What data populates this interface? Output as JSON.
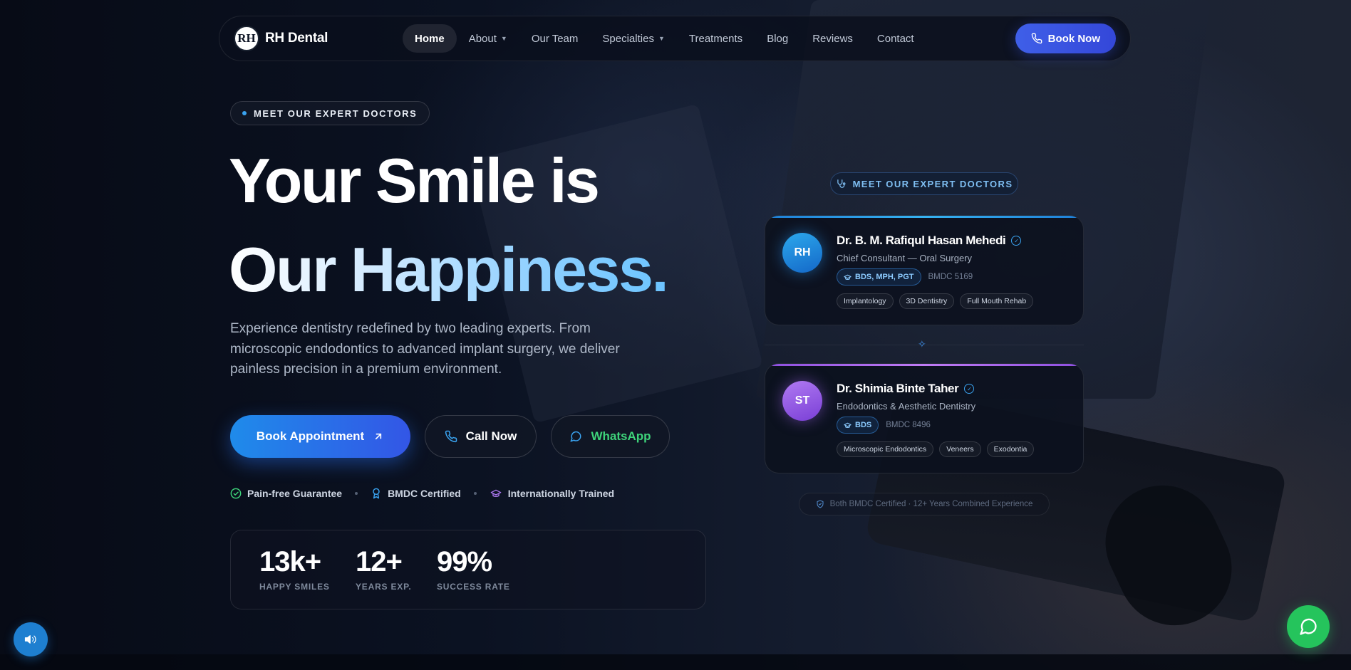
{
  "nav": {
    "brand_logo_text": "RH",
    "brand_name": "RH Dental",
    "items": [
      {
        "label": "Home",
        "active": true,
        "has_dropdown": false
      },
      {
        "label": "About",
        "active": false,
        "has_dropdown": true
      },
      {
        "label": "Our Team",
        "active": false,
        "has_dropdown": false
      },
      {
        "label": "Specialties",
        "active": false,
        "has_dropdown": true
      },
      {
        "label": "Treatments",
        "active": false,
        "has_dropdown": false
      },
      {
        "label": "Blog",
        "active": false,
        "has_dropdown": false
      },
      {
        "label": "Reviews",
        "active": false,
        "has_dropdown": false
      },
      {
        "label": "Contact",
        "active": false,
        "has_dropdown": false
      }
    ],
    "cta_label": "Book Now",
    "cta_icon": "phone-icon"
  },
  "hero": {
    "eyebrow": "MEET OUR EXPERT DOCTORS",
    "headline_line1": "Your Smile is",
    "headline_line2": "Our Happiness.",
    "lede": "Experience dentistry redefined by two leading experts. From microscopic endodontics to advanced implant surgery, we deliver painless precision in a premium environment.",
    "buttons": {
      "book": "Book Appointment",
      "call": "Call Now",
      "whatsapp": "WhatsApp"
    },
    "trust": [
      {
        "label": "Pain-free Guarantee",
        "icon": "check-circle-icon",
        "color": "#3ed37a"
      },
      {
        "label": "BMDC Certified",
        "icon": "award-icon",
        "color": "#3aa3f0"
      },
      {
        "label": "Internationally Trained",
        "icon": "graduation-cap-icon",
        "color": "#b07af2"
      }
    ],
    "stats": [
      {
        "value": "13k+",
        "label": "HAPPY SMILES"
      },
      {
        "value": "12+",
        "label": "YEARS EXP."
      },
      {
        "value": "99%",
        "label": "SUCCESS RATE"
      }
    ]
  },
  "doctors_panel": {
    "pill": "MEET OUR EXPERT DOCTORS",
    "doctors": [
      {
        "initials": "RH",
        "name": "Dr. B. M. Rafiqul Hasan Mehedi",
        "role": "Chief Consultant — Oral Surgery",
        "degree": "BDS, MPH, PGT",
        "registration": "BMDC 5169",
        "tags": [
          "Implantology",
          "3D Dentistry",
          "Full Mouth Rehab"
        ],
        "accent": "#2ca8ec"
      },
      {
        "initials": "ST",
        "name": "Dr. Shimia Binte Taher",
        "role": "Endodontics & Aesthetic Dentistry",
        "degree": "BDS",
        "registration": "BMDC 8496",
        "tags": [
          "Microscopic Endodontics",
          "Veneers",
          "Exodontia"
        ],
        "accent": "#b07af2"
      }
    ],
    "footer": "Both BMDC Certified · 12+ Years Combined Experience"
  },
  "floating": {
    "sound_icon": "volume-icon",
    "chat_icon": "chat-icon"
  },
  "colors": {
    "primary": "#3447d9",
    "accent_blue": "#2ca8ec",
    "accent_purple": "#b07af2",
    "whatsapp_green": "#25c45c"
  }
}
